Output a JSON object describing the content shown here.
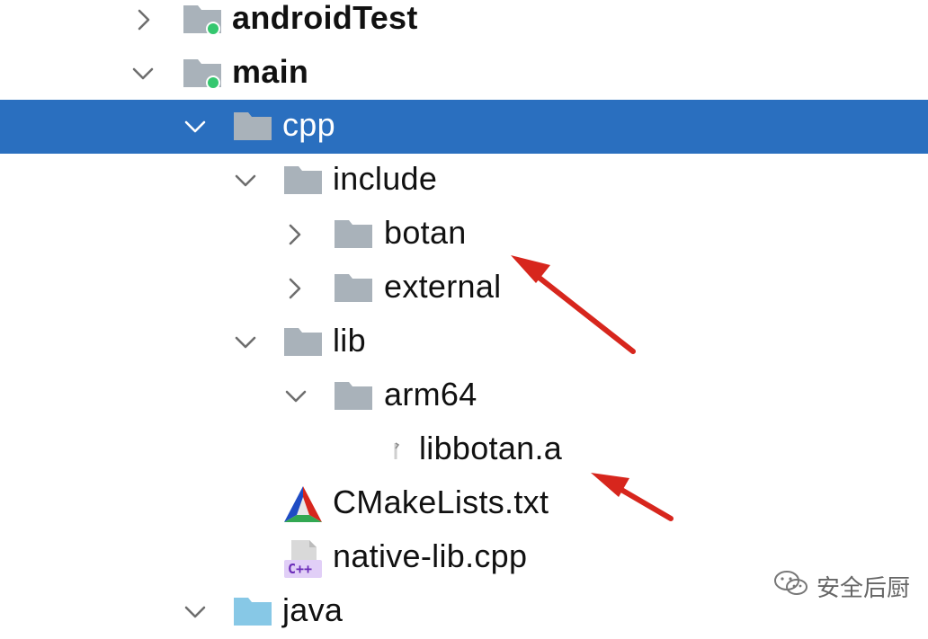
{
  "tree": {
    "items": [
      {
        "label": "androidTest",
        "icon": "module-folder-icon",
        "state": "collapsed"
      },
      {
        "label": "main",
        "icon": "module-folder-icon",
        "state": "expanded"
      },
      {
        "label": "cpp",
        "icon": "folder-icon",
        "state": "expanded",
        "selected": true
      },
      {
        "label": "include",
        "icon": "folder-icon",
        "state": "expanded"
      },
      {
        "label": "botan",
        "icon": "folder-icon",
        "state": "collapsed"
      },
      {
        "label": "external",
        "icon": "folder-icon",
        "state": "collapsed"
      },
      {
        "label": "lib",
        "icon": "folder-icon",
        "state": "expanded"
      },
      {
        "label": "arm64",
        "icon": "folder-icon",
        "state": "expanded"
      },
      {
        "label": "libbotan.a",
        "icon": "archive-file-icon"
      },
      {
        "label": "CMakeLists.txt",
        "icon": "cmake-icon"
      },
      {
        "label": "native-lib.cpp",
        "icon": "cpp-file-icon",
        "badge": "C++"
      },
      {
        "label": "java",
        "icon": "source-folder-icon",
        "state": "expanded"
      }
    ]
  },
  "colors": {
    "selection": "#2a6fbf",
    "folder": "#a9b2ba",
    "source_folder": "#87c8e6",
    "module_dot": "#35c76f",
    "annotation_arrow": "#d7261d"
  },
  "watermark": {
    "text": "安全后厨",
    "icon": "wechat-icon"
  }
}
